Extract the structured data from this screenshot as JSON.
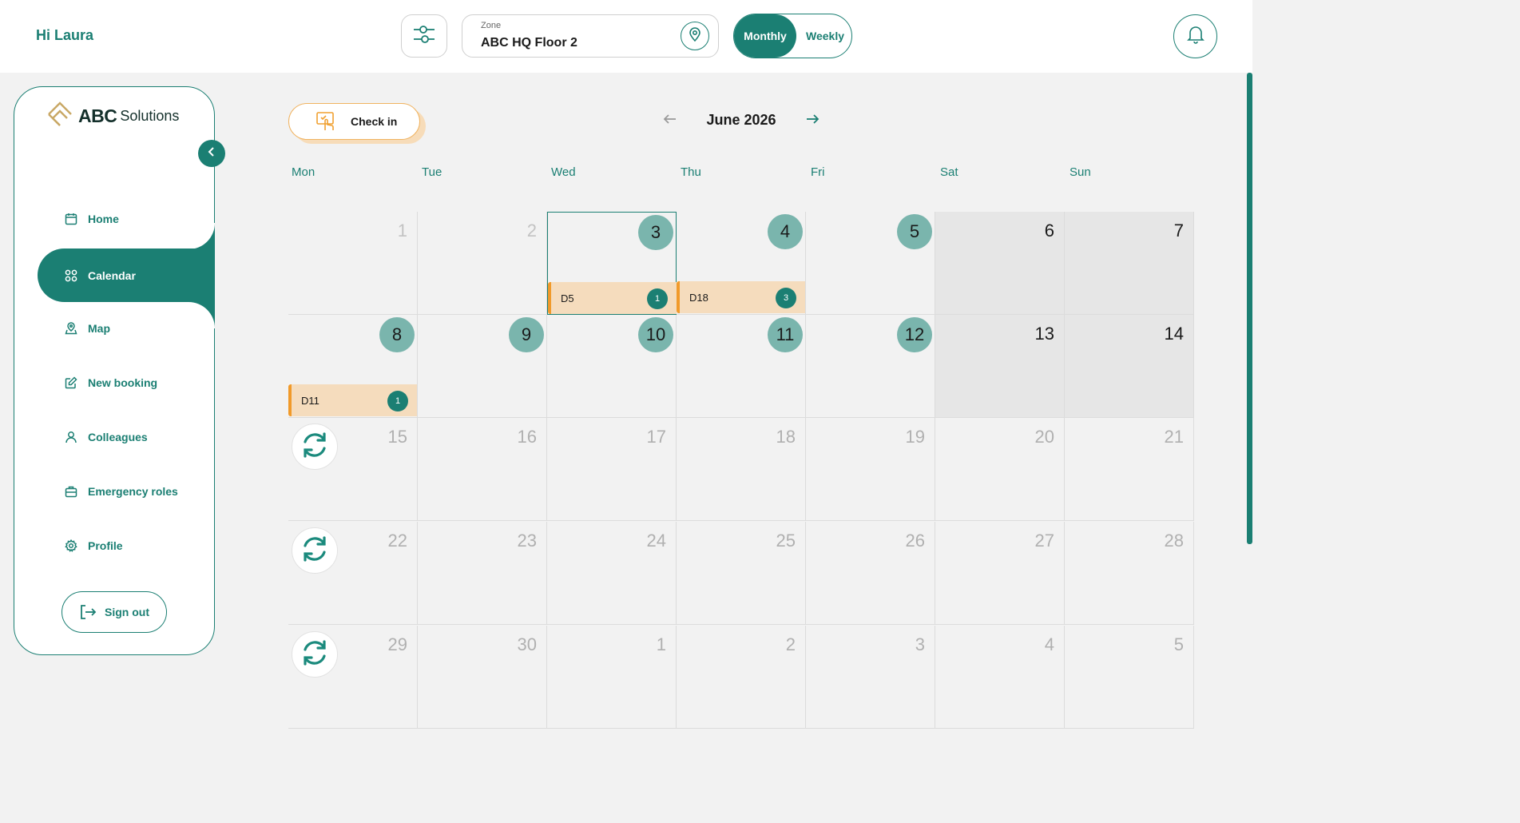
{
  "header": {
    "greeting": "Hi Laura",
    "zone_label": "Zone",
    "zone_value": "ABC HQ Floor 2",
    "view_monthly": "Monthly",
    "view_weekly": "Weekly"
  },
  "sidebar": {
    "logo_bold": "ABC",
    "logo_rest": "Solutions",
    "items": [
      {
        "label": "Home",
        "icon": "calendar-icon"
      },
      {
        "label": "Calendar",
        "icon": "grid-icon"
      },
      {
        "label": "Map",
        "icon": "map-pin-icon"
      },
      {
        "label": "New booking",
        "icon": "edit-icon"
      },
      {
        "label": "Colleagues",
        "icon": "user-icon"
      },
      {
        "label": "Emergency roles",
        "icon": "briefcase-icon"
      },
      {
        "label": "Profile",
        "icon": "gear-icon"
      }
    ],
    "sign_out": "Sign out"
  },
  "toolbar": {
    "check_in": "Check in",
    "month_title": "June 2026"
  },
  "calendar": {
    "weekdays": [
      "Mon",
      "Tue",
      "Wed",
      "Thu",
      "Fri",
      "Sat",
      "Sun"
    ],
    "weeks": [
      [
        {
          "day": "1",
          "style": "past"
        },
        {
          "day": "2",
          "style": "past"
        },
        {
          "day": "3",
          "style": "circle",
          "today": true,
          "booking": "D5",
          "count": "1"
        },
        {
          "day": "4",
          "style": "circle",
          "booking": "D18",
          "count": "3"
        },
        {
          "day": "5",
          "style": "circle"
        },
        {
          "day": "6",
          "style": "dark",
          "weekend": true
        },
        {
          "day": "7",
          "style": "dark",
          "weekend": true
        }
      ],
      [
        {
          "day": "8",
          "style": "circle",
          "booking": "D11",
          "count": "1"
        },
        {
          "day": "9",
          "style": "circle"
        },
        {
          "day": "10",
          "style": "circle"
        },
        {
          "day": "11",
          "style": "circle"
        },
        {
          "day": "12",
          "style": "circle"
        },
        {
          "day": "13",
          "style": "dark",
          "weekend": true
        },
        {
          "day": "14",
          "style": "dark",
          "weekend": true
        }
      ],
      [
        {
          "day": "15",
          "style": "muted",
          "repeat": true
        },
        {
          "day": "16",
          "style": "muted"
        },
        {
          "day": "17",
          "style": "muted"
        },
        {
          "day": "18",
          "style": "muted"
        },
        {
          "day": "19",
          "style": "muted"
        },
        {
          "day": "20",
          "style": "muted"
        },
        {
          "day": "21",
          "style": "muted"
        }
      ],
      [
        {
          "day": "22",
          "style": "muted",
          "repeat": true
        },
        {
          "day": "23",
          "style": "muted"
        },
        {
          "day": "24",
          "style": "muted"
        },
        {
          "day": "25",
          "style": "muted"
        },
        {
          "day": "26",
          "style": "muted"
        },
        {
          "day": "27",
          "style": "muted"
        },
        {
          "day": "28",
          "style": "muted"
        }
      ],
      [
        {
          "day": "29",
          "style": "muted",
          "repeat": true
        },
        {
          "day": "30",
          "style": "muted"
        },
        {
          "day": "1",
          "style": "muted"
        },
        {
          "day": "2",
          "style": "muted"
        },
        {
          "day": "3",
          "style": "muted"
        },
        {
          "day": "4",
          "style": "muted"
        },
        {
          "day": "5",
          "style": "muted"
        }
      ]
    ]
  },
  "colors": {
    "accent": "#1b7f73",
    "booking_bg": "#f5dcbd",
    "booking_edge": "#f19a2a",
    "day_circle": "#7ab5ad"
  }
}
